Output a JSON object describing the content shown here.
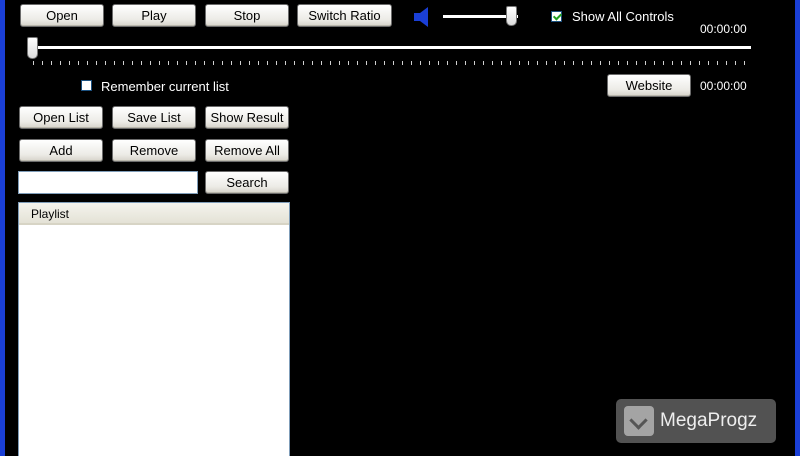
{
  "toolbar": {
    "open": "Open",
    "play": "Play",
    "stop": "Stop",
    "switch_ratio": "Switch Ratio"
  },
  "volume": {
    "level": 0.9,
    "icon": "speaker-icon"
  },
  "show_all_controls": {
    "label": "Show All Controls",
    "checked": true
  },
  "time_current": "00:00:00",
  "time_total": "00:00:00",
  "seek": {
    "position": 0.0
  },
  "remember_list": {
    "label": "Remember current list",
    "checked": false
  },
  "website_button": "Website",
  "list_buttons": {
    "open_list": "Open List",
    "save_list": "Save List",
    "show_result": "Show Result",
    "add": "Add",
    "remove": "Remove",
    "remove_all": "Remove All",
    "search": "Search"
  },
  "search": {
    "value": ""
  },
  "playlist": {
    "header": "Playlist",
    "items": []
  },
  "watermark": {
    "text": "MegaProgz",
    "icon": "megaprogz-logo-icon"
  },
  "colors": {
    "frame": "#1a3fd6",
    "background": "#000000",
    "checkmark": "#21a121",
    "speaker": "#1a3fd6"
  }
}
